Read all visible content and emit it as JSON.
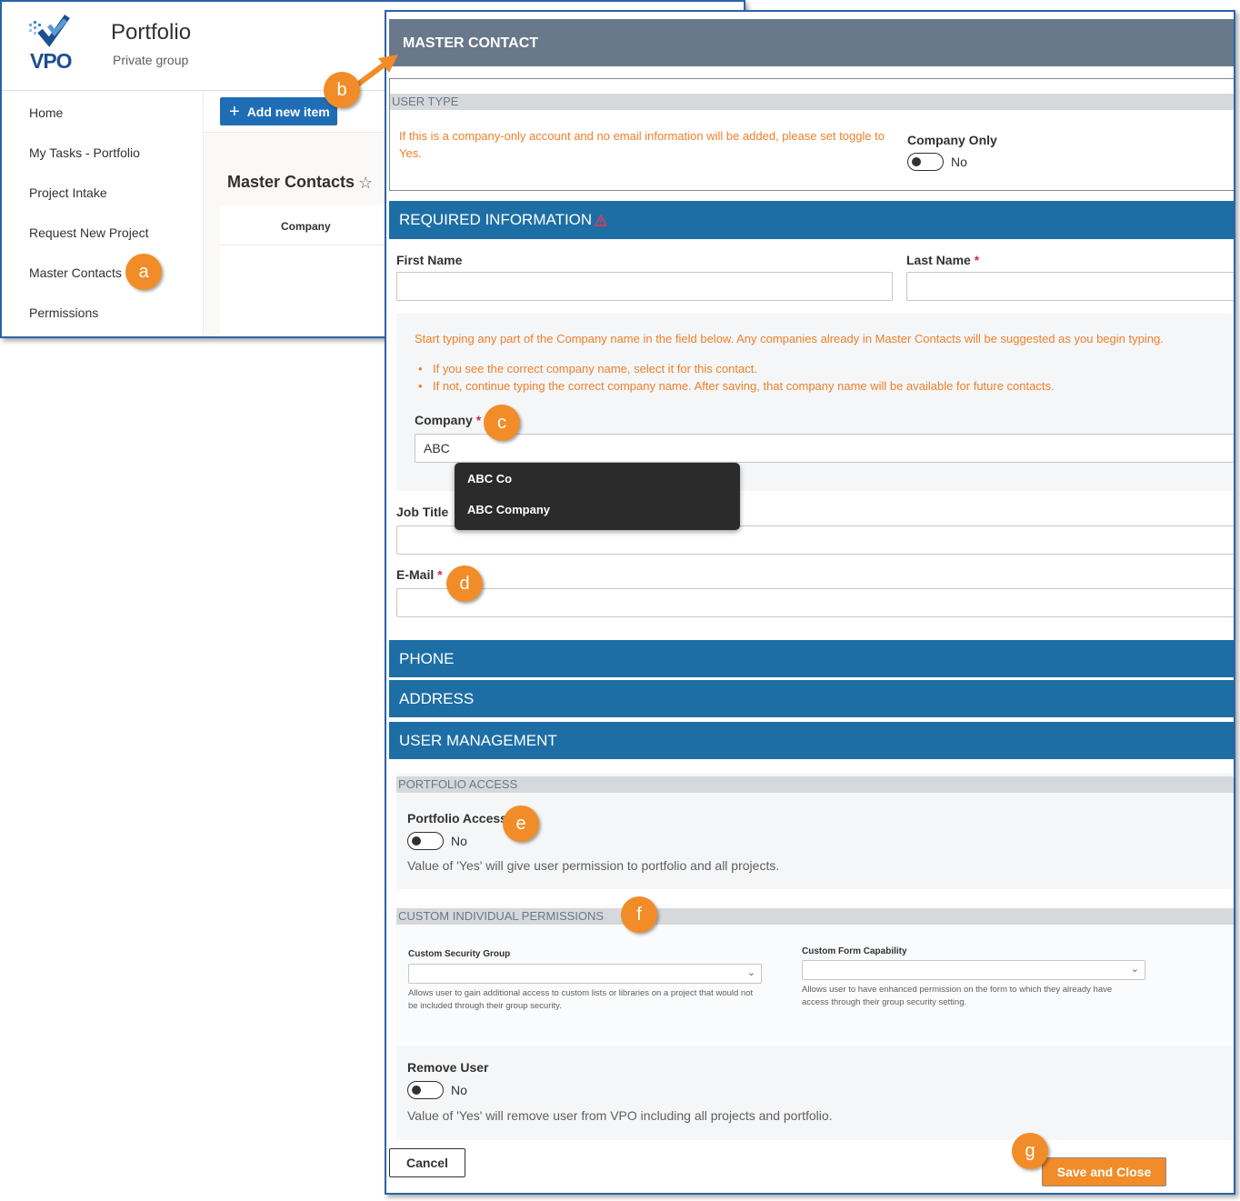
{
  "site": {
    "logo_text": "VPO",
    "title": "Portfolio",
    "subtitle": "Private group"
  },
  "nav": {
    "items": [
      {
        "label": "Home"
      },
      {
        "label": "My Tasks - Portfolio"
      },
      {
        "label": "Project Intake"
      },
      {
        "label": "Request New Project"
      },
      {
        "label": "Master Contacts"
      },
      {
        "label": "Permissions"
      }
    ]
  },
  "commandbar": {
    "add_label": "Add new item"
  },
  "list": {
    "title": "Master Contacts",
    "columns": [
      "Company"
    ]
  },
  "form": {
    "header": "MASTER CONTACT",
    "user_type": {
      "section": "USER TYPE",
      "note": "If this is a company-only account and no email information will be added, please set toggle to Yes.",
      "company_only_label": "Company Only",
      "company_only_value": "No"
    },
    "required": {
      "section": "REQUIRED INFORMATION",
      "first_name_label": "First Name",
      "first_name_value": "",
      "last_name_label": "Last Name",
      "last_name_value": "",
      "required_marker": "*",
      "company_note": "Start typing any part of the Company name in the field below. Any companies already in Master Contacts will be suggested as you begin typing.",
      "company_bullets": [
        "If you see the correct company name, select it for this contact.",
        "If not, continue typing the correct company name. After saving, that company name will be available for future contacts."
      ],
      "company_label": "Company",
      "company_value": "ABC",
      "suggestions": [
        "ABC Co",
        "ABC Company"
      ],
      "job_title_label": "Job Title",
      "job_title_value": "",
      "email_label": "E-Mail",
      "email_value": ""
    },
    "sections": {
      "phone": "PHONE",
      "address": "ADDRESS",
      "user_management": "USER MANAGEMENT"
    },
    "portfolio_access": {
      "section": "PORTFOLIO ACCESS",
      "label": "Portfolio Access",
      "value": "No",
      "help": "Value of 'Yes' will give user permission to portfolio and all projects."
    },
    "custom_permissions": {
      "section": "CUSTOM INDIVIDUAL PERMISSIONS",
      "security_group_label": "Custom Security Group",
      "security_group_value": "",
      "security_group_help": "Allows user to gain additional access to custom lists or libraries on a project that would not be included through their group security.",
      "form_capability_label": "Custom Form Capability",
      "form_capability_value": "",
      "form_capability_help": "Allows user to have enhanced permission on the form to which they already have access through their group security setting."
    },
    "remove_user": {
      "label": "Remove User",
      "value": "No",
      "help": "Value of 'Yes' will remove user from VPO including all projects and portfolio."
    },
    "buttons": {
      "cancel": "Cancel",
      "save": "Save and Close"
    }
  },
  "callouts": [
    "a",
    "b",
    "c",
    "d",
    "e",
    "f",
    "g"
  ],
  "colors": {
    "accent_blue": "#1e6ea6",
    "callout_orange": "#f28c28",
    "note_orange": "#f07f29",
    "header_gray": "#69788a"
  }
}
